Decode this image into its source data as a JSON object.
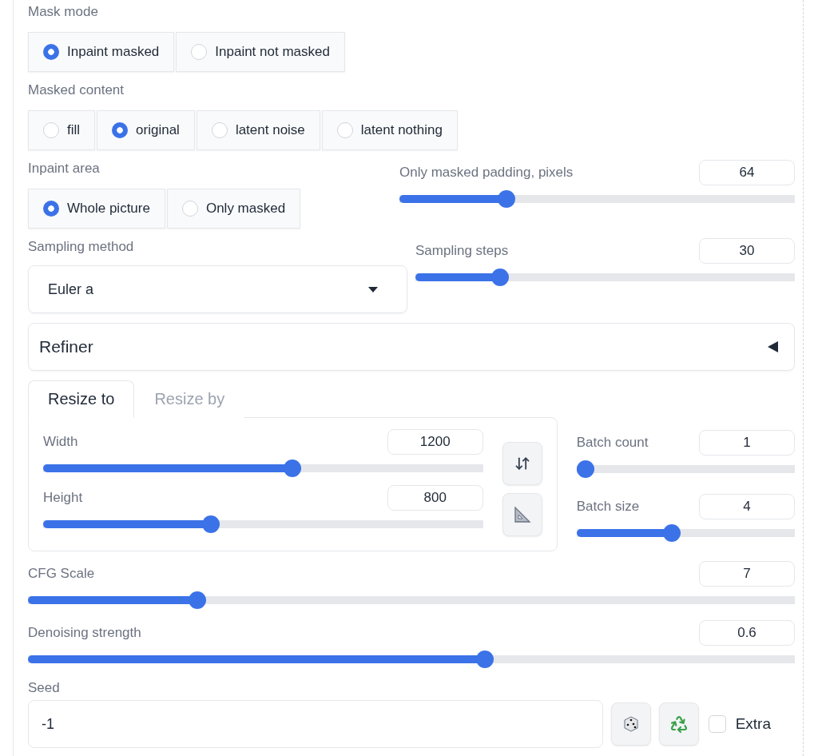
{
  "mask_mode": {
    "label": "Mask mode",
    "options": [
      {
        "label": "Inpaint masked",
        "selected": true
      },
      {
        "label": "Inpaint not masked",
        "selected": false
      }
    ]
  },
  "masked_content": {
    "label": "Masked content",
    "options": [
      {
        "label": "fill",
        "selected": false
      },
      {
        "label": "original",
        "selected": true
      },
      {
        "label": "latent noise",
        "selected": false
      },
      {
        "label": "latent nothing",
        "selected": false
      }
    ]
  },
  "inpaint_area": {
    "label": "Inpaint area",
    "options": [
      {
        "label": "Whole picture",
        "selected": true
      },
      {
        "label": "Only masked",
        "selected": false
      }
    ]
  },
  "only_masked_padding": {
    "label": "Only masked padding, pixels",
    "value": "64",
    "level": 0.26
  },
  "sampling_method": {
    "label": "Sampling method",
    "value": "Euler a"
  },
  "sampling_steps": {
    "label": "Sampling steps",
    "value": "30",
    "level": 0.21
  },
  "refiner": {
    "label": "Refiner",
    "expanded": false
  },
  "resize_tabs": [
    {
      "label": "Resize to",
      "selected": true
    },
    {
      "label": "Resize by",
      "selected": false
    }
  ],
  "width": {
    "label": "Width",
    "value": "1200",
    "level": 0.57
  },
  "height": {
    "label": "Height",
    "value": "800",
    "level": 0.376
  },
  "batch_count": {
    "label": "Batch count",
    "value": "1",
    "level": 0
  },
  "batch_size": {
    "label": "Batch size",
    "value": "4",
    "level": 0.43
  },
  "cfg_scale": {
    "label": "CFG Scale",
    "value": "7",
    "level": 0.214
  },
  "denoising_strength": {
    "label": "Denoising strength",
    "value": "0.6",
    "level": 0.598
  },
  "seed": {
    "label": "Seed",
    "value": "-1"
  },
  "extra": {
    "label": "Extra",
    "checked": false
  }
}
